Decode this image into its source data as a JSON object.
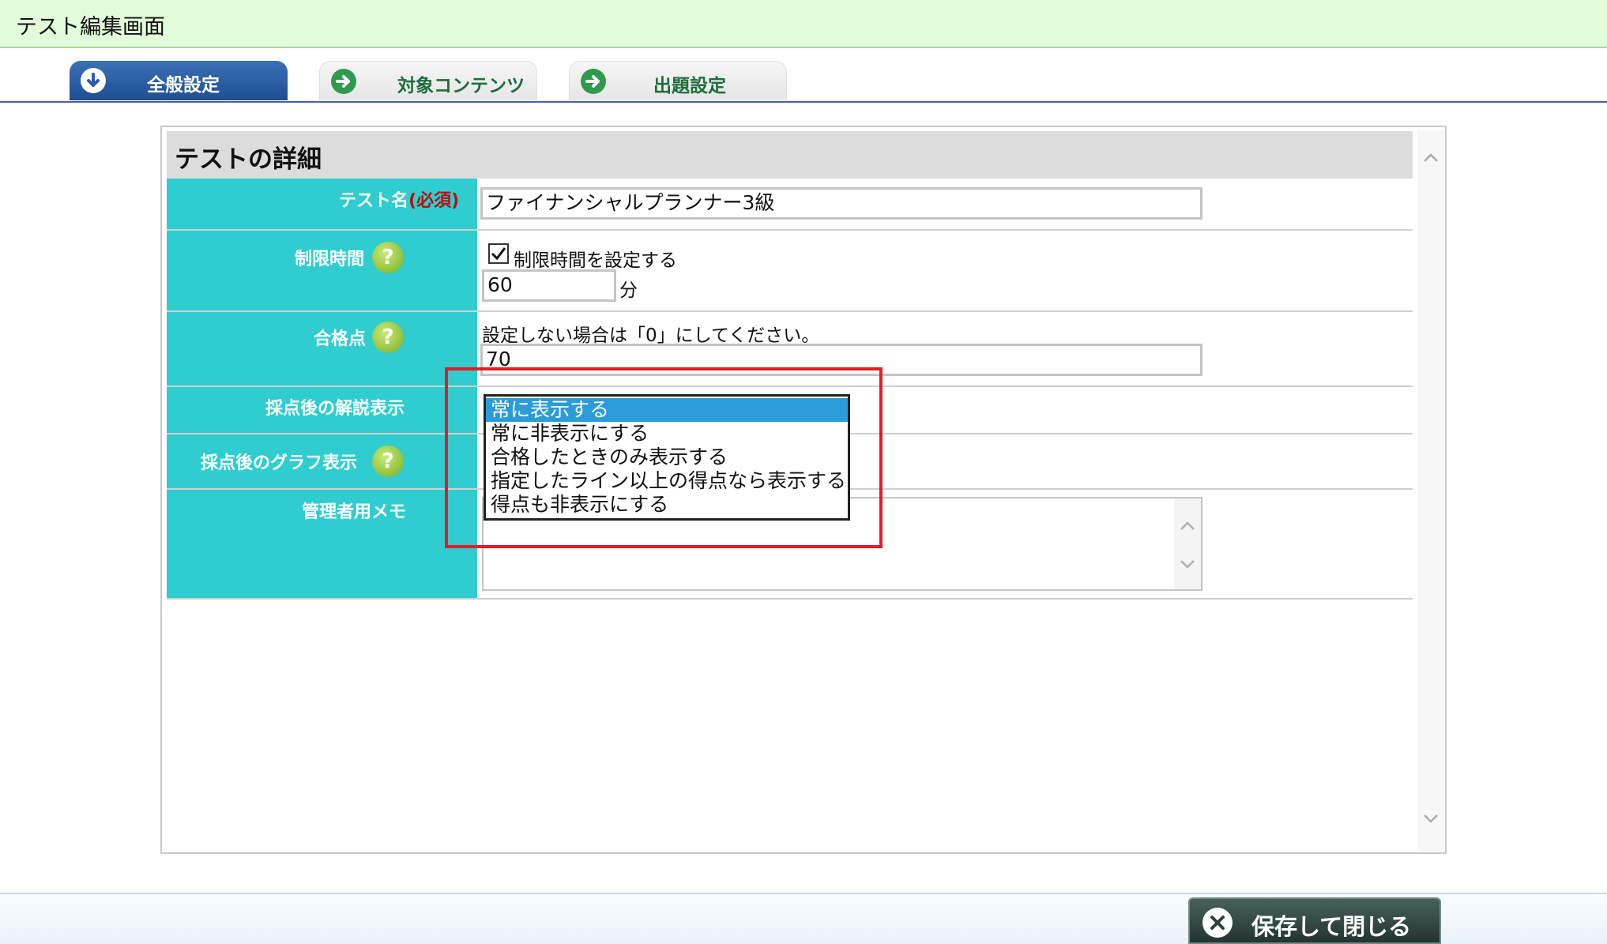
{
  "window": {
    "title": "テスト編集画面"
  },
  "tabs": [
    {
      "label": "全般設定",
      "icon": "arrow-down-circle-icon",
      "active": true
    },
    {
      "label": "対象コンテンツ",
      "icon": "arrow-right-circle-icon",
      "active": false
    },
    {
      "label": "出題設定",
      "icon": "arrow-right-circle-icon",
      "active": false
    }
  ],
  "section": {
    "title": "テストの詳細"
  },
  "form": {
    "test_name": {
      "label": "テスト名",
      "required": "(必須)",
      "value": "ファイナンシャルプランナー3級"
    },
    "time_limit": {
      "label": "制限時間",
      "checkbox_label": "制限時間を設定する",
      "checked": true,
      "value": "60",
      "unit": "分"
    },
    "passing_score": {
      "label": "合格点",
      "hint": "設定しない場合は「0」にしてください。",
      "value": "70"
    },
    "explanation_display": {
      "label": "採点後の解説表示",
      "options": [
        "常に表示する",
        "常に非表示にする",
        "合格したときのみ表示する",
        "指定したライン以上の得点なら表示する",
        "得点も非表示にする"
      ],
      "selected": "常に表示する"
    },
    "graph_display": {
      "label": "採点後のグラフ表示"
    },
    "admin_memo": {
      "label": "管理者用メモ",
      "value": ""
    }
  },
  "help_icon": "?",
  "footer": {
    "save_close_label": "保存して閉じる"
  },
  "colors": {
    "label_bg": "#30cdd0",
    "tab_active": "#2a5ea5",
    "title_bg": "#e2fbd9",
    "highlight": "#e01e26",
    "selected_option": "#2b9bd9"
  }
}
